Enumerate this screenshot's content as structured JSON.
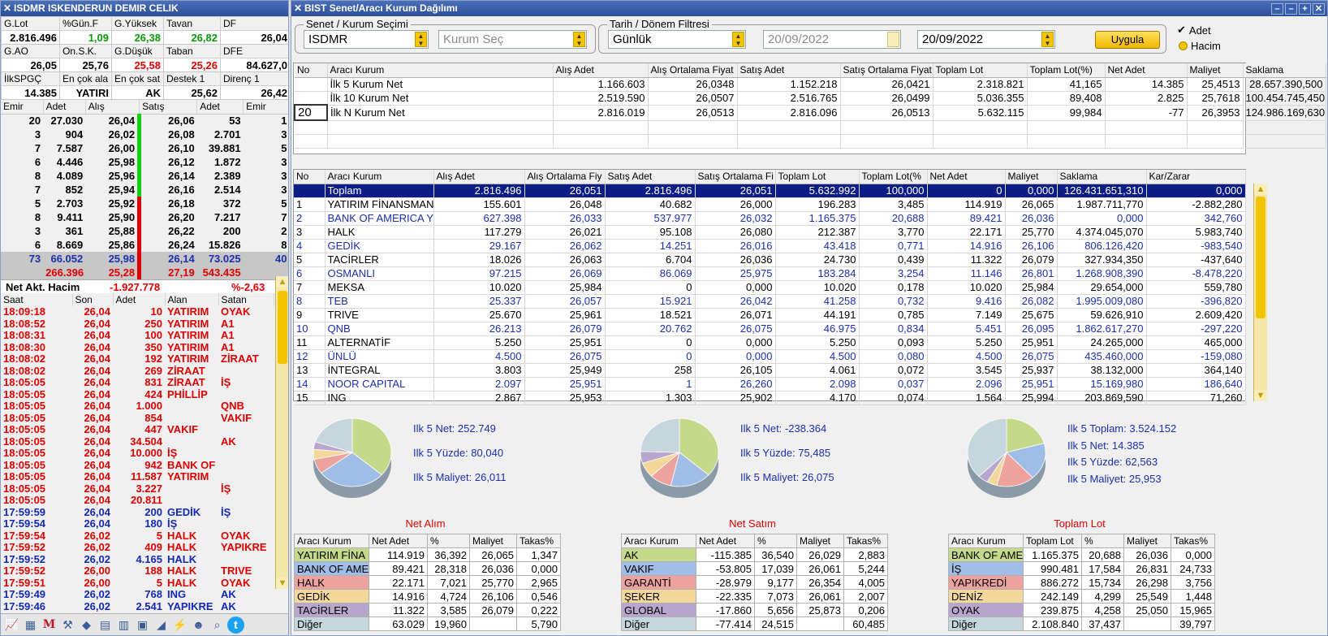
{
  "left": {
    "title": "ISDMR ISKENDERUN DEMIR CELIK",
    "summary": [
      {
        "labels": [
          "G.Lot",
          "%Gün.F",
          "G.Yüksek",
          "Tavan",
          "DF"
        ],
        "values": [
          "2.816.496",
          "1,09",
          "26,38",
          "26,82",
          "26,04"
        ],
        "colors": [
          "",
          "green",
          "green",
          "green",
          ""
        ]
      },
      {
        "labels": [
          "G.AO",
          "On.S.K.",
          "G.Düşük",
          "Taban",
          "DFE"
        ],
        "values": [
          "26,05",
          "25,76",
          "25,58",
          "25,26",
          "84.627,0"
        ],
        "colors": [
          "",
          "",
          "red",
          "red",
          ""
        ]
      },
      {
        "labels": [
          "İlkSPGÇ",
          "En çok ala",
          "En çok sat",
          "Destek 1",
          "Direnç 1"
        ],
        "values": [
          "14.385",
          "YATIRI",
          "AK",
          "25,62",
          "26,42"
        ],
        "colors": [
          "",
          "",
          "",
          "",
          ""
        ]
      }
    ],
    "orderbook_headers": [
      "Emir",
      "Adet",
      "Alış",
      "Satış",
      "Adet",
      "Emir"
    ],
    "orderbook": [
      [
        "20",
        "27.030",
        "26,04",
        "26,06",
        "53",
        "1"
      ],
      [
        "3",
        "904",
        "26,02",
        "26,08",
        "2.701",
        "3"
      ],
      [
        "7",
        "7.587",
        "26,00",
        "26,10",
        "39.881",
        "5"
      ],
      [
        "6",
        "4.446",
        "25,98",
        "26,12",
        "1.872",
        "3"
      ],
      [
        "8",
        "4.089",
        "25,96",
        "26,14",
        "2.389",
        "3"
      ],
      [
        "7",
        "852",
        "25,94",
        "26,16",
        "2.514",
        "3"
      ],
      [
        "5",
        "2.703",
        "25,92",
        "26,18",
        "372",
        "5"
      ],
      [
        "8",
        "9.411",
        "25,90",
        "26,20",
        "7.217",
        "7"
      ],
      [
        "3",
        "361",
        "25,88",
        "26,22",
        "200",
        "2"
      ],
      [
        "6",
        "8.669",
        "25,86",
        "26,24",
        "15.826",
        "8"
      ]
    ],
    "ob_sum1": [
      "73",
      "66.052",
      "25,98",
      "26,14",
      "73.025",
      "40"
    ],
    "ob_sum2": [
      "266.396",
      "25,28",
      "27,19",
      "543.435"
    ],
    "net_label": "Net Akt. Hacim",
    "net_value": "-1.927.778",
    "net_pct": "%-2,63",
    "trade_headers": [
      "Saat",
      "Son",
      "Adet",
      "Alan",
      "Satan"
    ],
    "trades": [
      [
        "18:09:18",
        "26,04",
        "10",
        "YATIRIM",
        "OYAK",
        "red"
      ],
      [
        "18:08:52",
        "26,04",
        "250",
        "YATIRIM",
        "A1",
        "red"
      ],
      [
        "18:08:31",
        "26,04",
        "100",
        "YATIRIM",
        "A1",
        "red"
      ],
      [
        "18:08:30",
        "26,04",
        "350",
        "YATIRIM",
        "A1",
        "red"
      ],
      [
        "18:08:02",
        "26,04",
        "192",
        "YATIRIM",
        "ZİRAAT",
        "red"
      ],
      [
        "18:08:02",
        "26,04",
        "269",
        "ZİRAAT",
        "",
        "red"
      ],
      [
        "18:05:05",
        "26,04",
        "831",
        "ZİRAAT",
        "İŞ",
        "red"
      ],
      [
        "18:05:05",
        "26,04",
        "424",
        "PHİLLİP",
        "",
        "red"
      ],
      [
        "18:05:05",
        "26,04",
        "1.000",
        "",
        "QNB",
        "red"
      ],
      [
        "18:05:05",
        "26,04",
        "854",
        "",
        "VAKIF",
        "red"
      ],
      [
        "18:05:05",
        "26,04",
        "447",
        "VAKIF",
        "",
        "red"
      ],
      [
        "18:05:05",
        "26,04",
        "34.504",
        "",
        "AK",
        "red"
      ],
      [
        "18:05:05",
        "26,04",
        "10.000",
        "İŞ",
        "",
        "red"
      ],
      [
        "18:05:05",
        "26,04",
        "942",
        "BANK OF",
        "",
        "red"
      ],
      [
        "18:05:05",
        "26,04",
        "11.587",
        "YATIRIM",
        "",
        "red"
      ],
      [
        "18:05:05",
        "26,04",
        "3.227",
        "",
        "İŞ",
        "red"
      ],
      [
        "18:05:05",
        "26,04",
        "20.811",
        "",
        "",
        "red"
      ],
      [
        "17:59:59",
        "26,04",
        "200",
        "GEDİK",
        "İŞ",
        "blue"
      ],
      [
        "17:59:54",
        "26,04",
        "180",
        "İŞ",
        "",
        "blue"
      ],
      [
        "17:59:54",
        "26,02",
        "5",
        "HALK",
        "OYAK",
        "red"
      ],
      [
        "17:59:52",
        "26,02",
        "409",
        "HALK",
        "YAPIKRE",
        "red"
      ],
      [
        "17:59:52",
        "26,02",
        "4.165",
        "HALK",
        "",
        "blue"
      ],
      [
        "17:59:52",
        "26,00",
        "188",
        "HALK",
        "TRIVE",
        "red"
      ],
      [
        "17:59:51",
        "26,00",
        "5",
        "HALK",
        "OYAK",
        "red"
      ],
      [
        "17:59:49",
        "26,02",
        "768",
        "ING",
        "AK",
        "blue"
      ],
      [
        "17:59:46",
        "26,02",
        "2.541",
        "YAPIKRE",
        "AK",
        "blue"
      ]
    ],
    "toolbar_icons": [
      "chart-icon",
      "image-icon",
      "m-logo-icon",
      "tools-icon",
      "diamond-icon",
      "document-icon",
      "calculator-icon",
      "folder-icon",
      "ruler-icon",
      "graph-icon",
      "users-icon",
      "search-icon",
      "twitter-icon"
    ]
  },
  "right": {
    "title": "BIST Senet/Aracı Kurum Dağılımı",
    "g1_legend": "Senet / Kurum Seçimi",
    "symbol": "ISDMR",
    "kurum_placeholder": "Kurum Seç",
    "g2_legend": "Tarih / Dönem Filtresi",
    "period": "Günlük",
    "date_from": "20/09/2022",
    "date_to": "20/09/2022",
    "apply": "Uygula",
    "radio_adet": "Adet",
    "radio_hacim": "Hacim",
    "top_headers": [
      "No",
      "Aracı Kurum",
      "Alış Adet",
      "Alış Ortalama Fiyat",
      "Satış Adet",
      "Satış Ortalama Fiyat",
      "Toplam Lot",
      "Toplam Lot(%)",
      "Net Adet",
      "Maliyet",
      "Saklama"
    ],
    "top_rows": [
      [
        "",
        "İlk 5 Kurum Net",
        "1.166.603",
        "26,0348",
        "1.152.218",
        "26,0421",
        "2.318.821",
        "41,165",
        "14.385",
        "25,4513",
        "28.657.390,500"
      ],
      [
        "",
        "İlk 10 Kurum Net",
        "2.519.590",
        "26,0507",
        "2.516.765",
        "26,0499",
        "5.036.355",
        "89,408",
        "2.825",
        "25,7618",
        "100.454.745,450"
      ],
      [
        "20",
        "İlk N Kurum Net",
        "2.816.019",
        "26,0513",
        "2.816.096",
        "26,0513",
        "5.632.115",
        "99,984",
        "-77",
        "26,3953",
        "124.986.169,630"
      ]
    ],
    "main_headers": [
      "No",
      "Aracı Kurum",
      "Alış Adet",
      "Alış Ortalama Fiy",
      "Satış Adet",
      "Satış Ortalama Fi",
      "Toplam Lot",
      "Toplam Lot(%",
      "Net Adet",
      "Maliyet",
      "Saklama",
      "Kar/Zarar"
    ],
    "main_rows": [
      [
        "",
        "Toplam",
        "2.816.496",
        "26,051",
        "2.816.496",
        "26,051",
        "5.632.992",
        "100,000",
        "0",
        "0,000",
        "126.431.651,310",
        "0,000"
      ],
      [
        "1",
        "YATIRIM FİNANSMAN",
        "155.601",
        "26,048",
        "40.682",
        "26,000",
        "196.283",
        "3,485",
        "114.919",
        "26,065",
        "1.987.711,770",
        "-2.882,280"
      ],
      [
        "2",
        "BANK OF AMERICA Y",
        "627.398",
        "26,033",
        "537.977",
        "26,032",
        "1.165.375",
        "20,688",
        "89.421",
        "26,036",
        "0,000",
        "342,760"
      ],
      [
        "3",
        "HALK",
        "117.279",
        "26,021",
        "95.108",
        "26,080",
        "212.387",
        "3,770",
        "22.171",
        "25,770",
        "4.374.045,070",
        "5.983,740"
      ],
      [
        "4",
        "GEDİK",
        "29.167",
        "26,062",
        "14.251",
        "26,016",
        "43.418",
        "0,771",
        "14.916",
        "26,106",
        "806.126,420",
        "-983,540"
      ],
      [
        "5",
        "TACİRLER",
        "18.026",
        "26,063",
        "6.704",
        "26,036",
        "24.730",
        "0,439",
        "11.322",
        "26,079",
        "327.934,350",
        "-437,640"
      ],
      [
        "6",
        "OSMANLI",
        "97.215",
        "26,069",
        "86.069",
        "25,975",
        "183.284",
        "3,254",
        "11.146",
        "26,801",
        "1.268.908,390",
        "-8.478,220"
      ],
      [
        "7",
        "MEKSA",
        "10.020",
        "25,984",
        "0",
        "0,000",
        "10.020",
        "0,178",
        "10.020",
        "25,984",
        "29.654,000",
        "559,780"
      ],
      [
        "8",
        "TEB",
        "25.337",
        "26,057",
        "15.921",
        "26,042",
        "41.258",
        "0,732",
        "9.416",
        "26,082",
        "1.995.009,080",
        "-396,820"
      ],
      [
        "9",
        "TRIVE",
        "25.670",
        "25,961",
        "18.521",
        "26,071",
        "44.191",
        "0,785",
        "7.149",
        "25,675",
        "59.626,910",
        "2.609,420"
      ],
      [
        "10",
        "QNB",
        "26.213",
        "26,079",
        "20.762",
        "26,075",
        "46.975",
        "0,834",
        "5.451",
        "26,095",
        "1.862.617,270",
        "-297,220"
      ],
      [
        "11",
        "ALTERNATİF",
        "5.250",
        "25,951",
        "0",
        "0,000",
        "5.250",
        "0,093",
        "5.250",
        "25,951",
        "24.265,000",
        "465,000"
      ],
      [
        "12",
        "ÜNLÜ",
        "4.500",
        "26,075",
        "0",
        "0,000",
        "4.500",
        "0,080",
        "4.500",
        "26,075",
        "435.460,000",
        "-159,080"
      ],
      [
        "13",
        "İNTEGRAL",
        "3.803",
        "25,949",
        "258",
        "26,105",
        "4.061",
        "0,072",
        "3.545",
        "25,937",
        "38.132,000",
        "364,140"
      ],
      [
        "14",
        "NOOR CAPITAL",
        "2.097",
        "25,951",
        "1",
        "26,260",
        "2.098",
        "0,037",
        "2.096",
        "25,951",
        "15.169,980",
        "186,640"
      ],
      [
        "15",
        "ING",
        "2.867",
        "25,953",
        "1.303",
        "25,902",
        "4.170",
        "0,074",
        "1.564",
        "25,994",
        "203.869,590",
        "71,260"
      ]
    ],
    "panels": [
      {
        "title": "Net Alım",
        "stats": [
          "Ilk 5 Net: 252.749",
          "Ilk 5 Yüzde: 80,040",
          "Ilk 5 Maliyet: 26,011"
        ],
        "headers": [
          "Aracı Kurum",
          "Net Adet",
          "%",
          "Maliyet",
          "Takas%"
        ],
        "rows": [
          [
            "YATIRIM FİNA",
            "114.919",
            "36,392",
            "26,065",
            "1,347"
          ],
          [
            "BANK OF AME",
            "89.421",
            "28,318",
            "26,036",
            "0,000"
          ],
          [
            "HALK",
            "22.171",
            "7,021",
            "25,770",
            "2,965"
          ],
          [
            "GEDİK",
            "14.916",
            "4,724",
            "26,106",
            "0,546"
          ],
          [
            "TACİRLER",
            "11.322",
            "3,585",
            "26,079",
            "0,222"
          ],
          [
            "Diğer",
            "63.029",
            "19,960",
            "",
            "5,790"
          ]
        ],
        "slices": [
          36.392,
          28.318,
          7.021,
          4.724,
          3.585,
          19.96
        ]
      },
      {
        "title": "Net Satım",
        "stats": [
          "Ilk 5 Net: -238.364",
          "Ilk 5 Yüzde: 75,485",
          "Ilk 5 Maliyet: 26,075"
        ],
        "headers": [
          "Aracı Kurum",
          "Net Adet",
          "%",
          "Maliyet",
          "Takas%"
        ],
        "rows": [
          [
            "AK",
            "-115.385",
            "36,540",
            "26,029",
            "2,883"
          ],
          [
            "VAKIF",
            "-53.805",
            "17,039",
            "26,061",
            "5,244"
          ],
          [
            "GARANTİ",
            "-28.979",
            "9,177",
            "26,354",
            "4,005"
          ],
          [
            "ŞEKER",
            "-22.335",
            "7,073",
            "26,061",
            "2,007"
          ],
          [
            "GLOBAL",
            "-17.860",
            "5,656",
            "25,873",
            "0,206"
          ],
          [
            "Diğer",
            "-77.414",
            "24,515",
            "",
            "60,485"
          ]
        ],
        "slices": [
          36.54,
          17.039,
          9.177,
          7.073,
          5.656,
          24.515
        ]
      },
      {
        "title": "Toplam Lot",
        "stats": [
          "Ilk 5 Toplam: 3.524.152",
          "Ilk 5 Net: 14.385",
          "Ilk 5 Yüzde: 62,563",
          "Ilk 5 Maliyet: 25,953"
        ],
        "headers": [
          "Aracı Kurum",
          "Toplam Lot",
          "%",
          "Maliyet",
          "Takas%"
        ],
        "rows": [
          [
            "BANK OF AME",
            "1.165.375",
            "20,688",
            "26,036",
            "0,000"
          ],
          [
            "İŞ",
            "990.481",
            "17,584",
            "26,831",
            "24,733"
          ],
          [
            "YAPIKREDİ",
            "886.272",
            "15,734",
            "26,298",
            "3,756"
          ],
          [
            "DENİZ",
            "242.149",
            "4,299",
            "25,549",
            "1,448"
          ],
          [
            "OYAK",
            "239.875",
            "4,258",
            "25,050",
            "15,965"
          ],
          [
            "Diğer",
            "2.108.840",
            "37,437",
            "",
            "39,797"
          ]
        ],
        "slices": [
          20.688,
          17.584,
          15.734,
          4.299,
          4.258,
          37.437
        ]
      }
    ],
    "slice_colors": [
      "#c4d98a",
      "#9fbde6",
      "#eda29e",
      "#f4d79a",
      "#b8a6cf",
      "#c5d6dc"
    ]
  }
}
